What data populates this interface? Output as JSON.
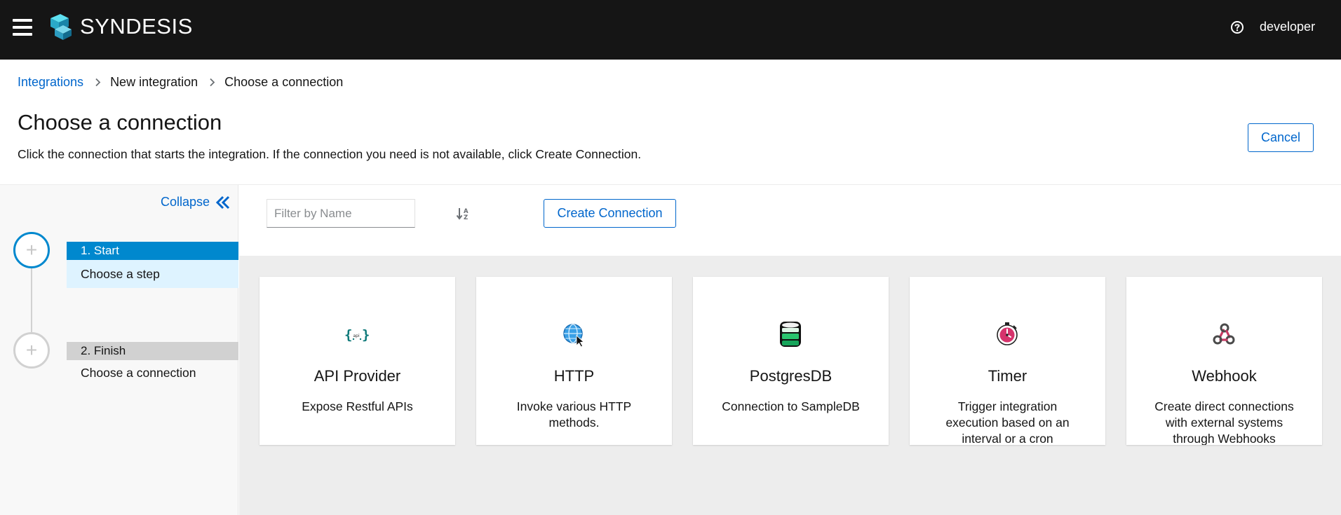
{
  "topbar": {
    "brand": "SYNDESIS",
    "user": "developer",
    "icons": {
      "menu": "hamburger-icon",
      "logo": "syndesis-logo",
      "help": "help-icon"
    }
  },
  "breadcrumb": {
    "items": [
      "Integrations",
      "New integration",
      "Choose a connection"
    ]
  },
  "page": {
    "title": "Choose a connection",
    "description": "Click the connection that starts the integration. If the connection you need is not available, click Create Connection.",
    "cancel_label": "Cancel"
  },
  "sidebar": {
    "collapse_label": "Collapse",
    "steps": [
      {
        "title": "1. Start",
        "subtitle": "Choose a step",
        "active": true
      },
      {
        "title": "2. Finish",
        "subtitle": "Choose a connection",
        "active": false
      }
    ]
  },
  "toolbar": {
    "filter_placeholder": "Filter by Name",
    "create_label": "Create Connection"
  },
  "cards": [
    {
      "title": "API Provider",
      "description": "Expose Restful APIs",
      "icon": "api-provider-icon"
    },
    {
      "title": "HTTP",
      "description": "Invoke various HTTP methods.",
      "icon": "http-globe-icon"
    },
    {
      "title": "PostgresDB",
      "description": "Connection to SampleDB",
      "icon": "database-icon"
    },
    {
      "title": "Timer",
      "description": "Trigger integration execution based on an interval or a cron expression.",
      "icon": "timer-icon"
    },
    {
      "title": "Webhook",
      "description": "Create direct connections with external systems through Webhooks",
      "icon": "webhook-icon"
    }
  ],
  "colors": {
    "topbar_bg": "#151515",
    "link": "#0066cc",
    "active_step": "#0088ce",
    "active_step_sub": "#def3ff",
    "content_bg": "#ededed"
  }
}
